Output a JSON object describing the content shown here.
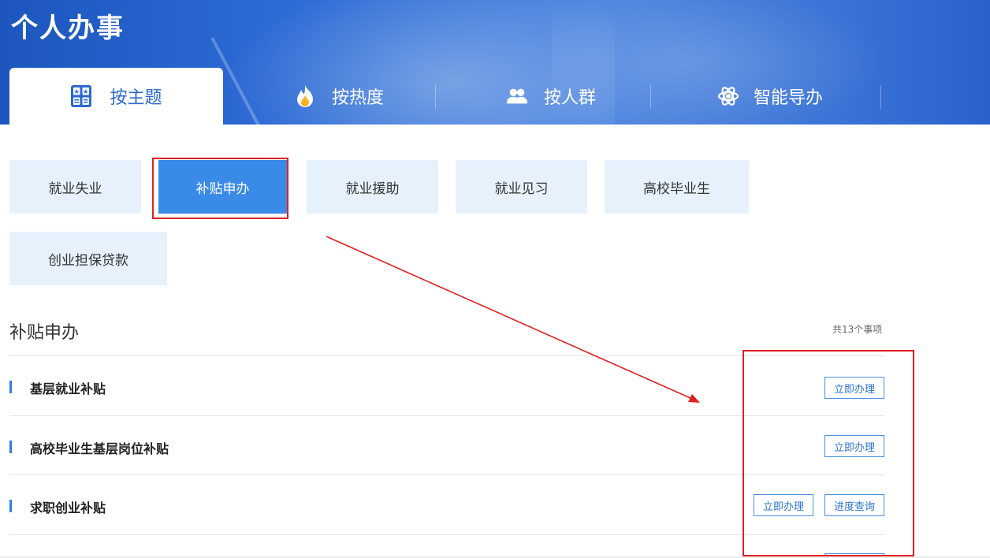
{
  "page": {
    "title": "个人办事"
  },
  "tabs": [
    {
      "label": "按主题",
      "icon": "grid-icon",
      "active": true
    },
    {
      "label": "按热度",
      "icon": "flame-icon",
      "active": false
    },
    {
      "label": "按人群",
      "icon": "people-icon",
      "active": false
    },
    {
      "label": "智能导办",
      "icon": "gear-icon",
      "active": false
    }
  ],
  "categories": [
    {
      "label": "就业失业",
      "active": false
    },
    {
      "label": "补贴申办",
      "active": true
    },
    {
      "label": "就业援助",
      "active": false
    },
    {
      "label": "就业见习",
      "active": false
    },
    {
      "label": "高校毕业生",
      "active": false
    },
    {
      "label": "创业担保贷款",
      "active": false
    }
  ],
  "section": {
    "title": "补贴申办",
    "count": "共13个事项",
    "items": [
      {
        "name": "基层就业补贴",
        "actions": [
          "立即办理"
        ]
      },
      {
        "name": "高校毕业生基层岗位补贴",
        "actions": [
          "立即办理"
        ]
      },
      {
        "name": "求职创业补贴",
        "actions": [
          "立即办理",
          "进度查询"
        ]
      }
    ]
  },
  "colors": {
    "accent": "#2f7ee0",
    "banner": "#2d6cd6",
    "annotation": "#e02020",
    "category_bg": "#e6f1fc"
  }
}
